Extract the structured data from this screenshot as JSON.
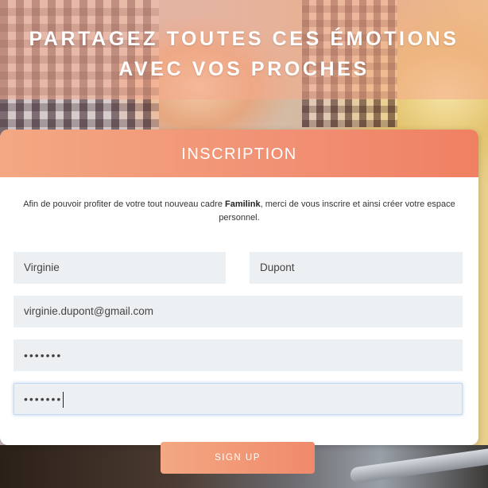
{
  "hero": {
    "title_line1": "PARTAGEZ TOUTES CES ÉMOTIONS",
    "title_line2": "AVEC VOS PROCHES"
  },
  "form": {
    "header": "INSCRIPTION",
    "intro_before": "Afin de pouvoir profiter de votre tout nouveau cadre ",
    "intro_brand": "Familink",
    "intro_after": ", merci de vous inscrire et ainsi créer votre espace personnel.",
    "first_name": "Virginie",
    "last_name": "Dupont",
    "email": "virginie.dupont@gmail.com",
    "password": "•••••••",
    "password_confirm": "•••••••",
    "submit_label": "SIGN UP"
  },
  "colors": {
    "accent_start": "#f3a882",
    "accent_end": "#f08062",
    "field_bg": "#edf0f2"
  }
}
